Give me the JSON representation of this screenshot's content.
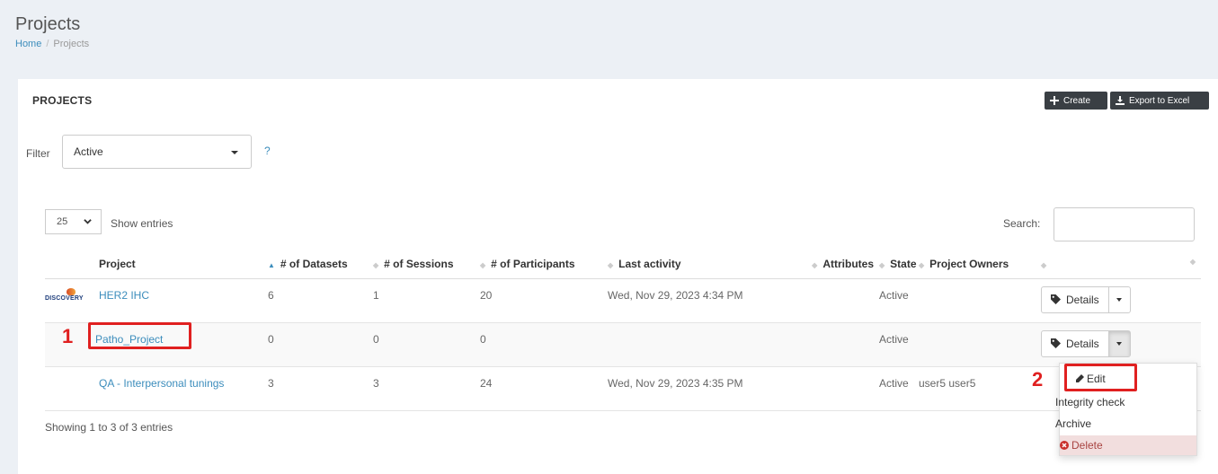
{
  "header": {
    "title": "Projects",
    "breadcrumb": {
      "home": "Home",
      "sep": "/",
      "current": "Projects"
    }
  },
  "box": {
    "title": "PROJECTS",
    "create_label": "Create",
    "export_label": "Export to Excel"
  },
  "filter": {
    "label": "Filter",
    "value": "Active",
    "help": "?"
  },
  "table_controls": {
    "length_value": "25",
    "length_label": "Show entries",
    "search_label": "Search:"
  },
  "columns": [
    "Project",
    "# of Datasets",
    "# of Sessions",
    "# of Participants",
    "Last activity",
    "Attributes",
    "State",
    "Project Owners"
  ],
  "rows": [
    {
      "logo": "DISCOVERY",
      "project": "HER2 IHC",
      "datasets": "6",
      "sessions": "1",
      "participants": "20",
      "last_activity": "Wed, Nov 29, 2023 4:34 PM",
      "attributes": "",
      "state": "Active",
      "owners": ""
    },
    {
      "logo": "",
      "project": "Patho_Project",
      "datasets": "0",
      "sessions": "0",
      "participants": "0",
      "last_activity": "",
      "attributes": "",
      "state": "Active",
      "owners": ""
    },
    {
      "logo": "",
      "project": "QA - Interpersonal tunings",
      "datasets": "3",
      "sessions": "3",
      "participants": "24",
      "last_activity": "Wed, Nov 29, 2023 4:35 PM",
      "attributes": "",
      "state": "Active",
      "owners": "user5 user5"
    }
  ],
  "row_action": {
    "details_label": "Details"
  },
  "dropdown": {
    "edit": "Edit",
    "integrity": "Integrity check",
    "archive": "Archive",
    "delete": "Delete"
  },
  "footer": {
    "showing": "Showing 1 to 3 of 3 entries"
  },
  "annotations": {
    "one": "1",
    "two": "2"
  },
  "colors": {
    "link": "#3c8dbc",
    "annotation": "#e02020",
    "dark_button": "#3a3f44",
    "danger_bg": "#f2dede"
  }
}
